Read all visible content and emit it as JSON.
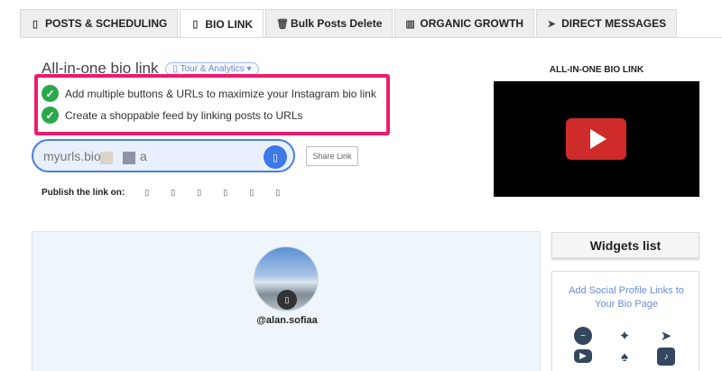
{
  "tabs": [
    {
      "label": "POSTS & SCHEDULING",
      "icon": "phone-icon"
    },
    {
      "label": "BIO LINK",
      "icon": "phone-icon"
    },
    {
      "label": "Bulk Posts Delete",
      "icon": "trash-icon"
    },
    {
      "label": "ORGANIC GROWTH",
      "icon": "bar-chart-icon"
    },
    {
      "label": "DIRECT MESSAGES",
      "icon": "paper-plane-icon"
    }
  ],
  "header": {
    "title": "All-in-one bio link",
    "tour_label": "Tour & Analytics"
  },
  "features": [
    "Add multiple buttons & URLs to maximize your Instagram bio link",
    "Create a shoppable feed by linking posts to URLs"
  ],
  "link": {
    "prefix": "myurls.bio/",
    "suffix": "a",
    "share_label": "Share Link"
  },
  "publish": {
    "label": "Publish the link on:",
    "icons": [
      "instagram-icon",
      "facebook-icon",
      "twitter-icon",
      "linkedin-icon",
      "tiktok-icon",
      "youtube-icon"
    ]
  },
  "video": {
    "title": "ALL-IN-ONE BIO LINK"
  },
  "profile": {
    "username": "@alan.sofiaa"
  },
  "widgets": {
    "title": "Widgets list",
    "description": "Add Social Profile Links to Your Bio Page",
    "icons": [
      "messenger-icon",
      "twitter-icon",
      "telegram-icon",
      "youtube-icon",
      "snapchat-icon",
      "tiktok-icon"
    ]
  },
  "colors": {
    "highlight": "#ee1c6e",
    "accent_blue": "#3e79e8",
    "check_green": "#2aa84a",
    "play_red": "#cf2b2b"
  }
}
